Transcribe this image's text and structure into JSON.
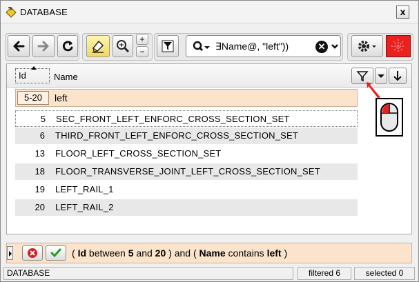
{
  "window": {
    "title": "DATABASE",
    "close_label": "x"
  },
  "toolbar": {
    "search_text": "∃Name@, \"left\"))"
  },
  "grid": {
    "columns": {
      "id": "Id",
      "name": "Name"
    },
    "filter": {
      "id": "5-20",
      "name": "left"
    },
    "rows": [
      {
        "id": "5",
        "name": "SEC_FRONT_LEFT_ENFORC_CROSS_SECTION_SET"
      },
      {
        "id": "6",
        "name": "THIRD_FRONT_LEFT_ENFORC_CROSS_SECTION_SET"
      },
      {
        "id": "13",
        "name": "FLOOR_LEFT_CROSS_SECTION_SET"
      },
      {
        "id": "18",
        "name": "FLOOR_TRANSVERSE_JOINT_LEFT_CROSS_SECTION_SET"
      },
      {
        "id": "19",
        "name": "LEFT_RAIL_1"
      },
      {
        "id": "20",
        "name": "LEFT_RAIL_2"
      }
    ]
  },
  "summary": {
    "open_paren": "(",
    "field1": "Id",
    "op1": "between",
    "v1": "5",
    "and_word": "and",
    "v2": "20",
    "mid": ") and (",
    "field2": "Name",
    "op2": "contains",
    "v3": "left",
    "close_paren": ")"
  },
  "status": {
    "left": "DATABASE",
    "filtered": "filtered 6",
    "selected": "selected 0"
  },
  "colors": {
    "filter_bg": "#fbe3cc",
    "accent_red": "#e8211e",
    "alt_row": "#e8e8e8"
  },
  "icons": [
    "database-icon",
    "close-icon",
    "back-arrow-icon",
    "forward-arrow-icon",
    "refresh-icon",
    "highlight-icon",
    "zoom-icon",
    "zoom-in-icon",
    "zoom-out-icon",
    "filter-icon",
    "search-icon",
    "clear-icon",
    "chevron-down-icon",
    "gear-icon",
    "red-grid-icon",
    "funnel-icon",
    "sort-down-icon",
    "cancel-filter-icon",
    "apply-filter-icon",
    "mouse-icon",
    "expand-handle-icon"
  ]
}
